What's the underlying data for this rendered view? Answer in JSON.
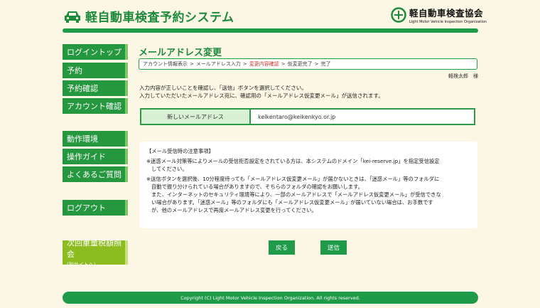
{
  "header": {
    "site_title": "軽自動車検査予約システム",
    "org_name_ja": "軽自動車検査協会",
    "org_name_en": "Light Motor Vehicle Inspection Organization"
  },
  "sidebar": {
    "items": [
      {
        "label": "ログイントップ"
      },
      {
        "label": "予約"
      },
      {
        "label": "予約確認"
      },
      {
        "label": "アカウント確認"
      },
      {
        "label": "動作環境"
      },
      {
        "label": "操作ガイド"
      },
      {
        "label": "よくあるご質問"
      },
      {
        "label": "ログアウト"
      }
    ],
    "tax_link": {
      "label": "次回重量税額照会",
      "sub": "(別サイトへ)"
    }
  },
  "main": {
    "title": "メールアドレス変更",
    "breadcrumb": [
      "アカウント情報表示",
      "メールアドレス入力",
      "変更内容確認",
      "仮変更完了",
      "完了"
    ],
    "breadcrumb_sep": ">",
    "user_name": "軽検太郎　様",
    "instructions": [
      "入力内容が正しいことを確認し、「送信」ボタンを選択してください。",
      "入力していただいたメールアドレス宛に、確認用の「メールアドレス仮変更メール」が送信されます。"
    ],
    "field": {
      "label": "新しいメールアドレス",
      "value": "keikentaro@keikenkyo.or.jp"
    },
    "notice": {
      "heading": "【メール受信時の注意事項】",
      "p1_line1": "※迷惑メール対策等によりメールの受信拒否設定をされている方は、本システムのドメイン「kei-reserve.jp」を指定受信設定",
      "p1_line2": "してください。",
      "p2_line1": "※送信ボタンを選択後、10分程度待っても「メールアドレス仮変更メール」が届かないときは、「迷惑メール」等のフォルダに",
      "p2_line2": "自動で振り分けられている場合がありますので、そちらのフォルダの確認をお願いします。",
      "p2_line3": "また、インターネットのセキュリティ環境等により、一部のメールアドレスで「メールアドレス仮変更メール」が受信できな",
      "p2_line4": "い場合があります。「迷惑メール」等のフォルダにも「メールアドレス仮変更メール」が届いていない場合は、お手数です",
      "p2_line5": "が、他のメールアドレスで再度メールアドレス変更を行ってください。"
    },
    "back_label": "戻る",
    "send_label": "送信"
  },
  "footer": {
    "copyright": "Copyright (C) Light Motor Vehicle Inspection Organization. All rights reserved."
  },
  "colors": {
    "primary": "#1f9a48",
    "accent": "#8cbc20",
    "background": "#fbf7e4",
    "current_step": "#d0342c"
  }
}
